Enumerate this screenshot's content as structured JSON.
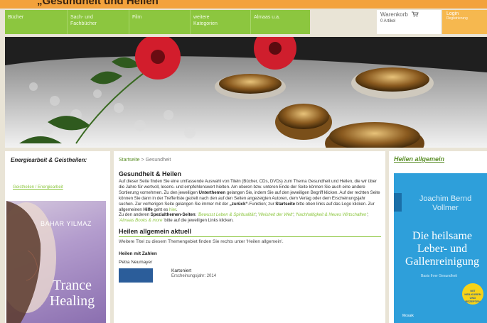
{
  "caption": "„Gesundheit und Heilen",
  "nav": {
    "items": [
      "Bücher",
      "Sach- und Fachbücher",
      "Film",
      "weitere Kategorien",
      "Almaas u.a."
    ],
    "cart_label": "Warenkorb",
    "cart_count": "0 Artikel",
    "login_label": "Login",
    "login_sub": "Registrierung"
  },
  "left": {
    "heading": "Energiearbeit & Geistheilen:",
    "link": "Geistheilen / Energiearbeit",
    "book_author": "BAHAR YILMAZ",
    "book_title": "Trance Healing"
  },
  "main": {
    "breadcrumb_home": "Startseite",
    "breadcrumb_sep": " > ",
    "breadcrumb_current": "Gesundheit",
    "title": "Gesundheit & Heilen",
    "p1": "Auf dieser Seite finden Sie eine umfassende Auswahl von Titeln (Bücher, CDs, DVDs) zum Thema Gesundheit und Heilen, die wir über die Jahre für wertvoll, lesens- und empfehlenswert hielten. Am oberen bzw. unteren Ende der Seite können Sie auch eine andere Sortierung vornehmen. Zu den jeweiligen ",
    "p1_bold": "Unterthemen",
    "p1b": " gelangen Sie, indem Sie auf den jeweiligen Begriff klicken. Auf der rechten Seite können Sie dann in der Trefferliste gezielt nach den auf den Seiten angezeigten Autoren, dem Verlag oder dem Erscheinungsjahr suchen. Zur vorherigen Seite gelangen Sie immer mit der ",
    "p1_bold2": "„zurück“",
    "p1c": "-Funktion; zur ",
    "p1_bold3": "Startseite",
    "p1d": " bitte oben links auf das Logo klicken. Zur allgemeinen ",
    "p1_bold4": "Hilfe",
    "p1e": " geht es ",
    "p1_link": "hier",
    "p1f": ".",
    "p2": "Zu den anderen ",
    "p2_bold": "Spezialthemen-Seiten",
    "p2b": ": ",
    "p2_link1": "'Bewusst Leben & Spiritualität'",
    "p2c": "; ",
    "p2_link2": "'Weisheit der Welt'",
    "p2d": "; ",
    "p2_link3": "'Nachhaltigkeit & Neues Wirtschaften'",
    "p2e": "; ",
    "p2_link4": "'Almaas Books & more'",
    "p2f": " bitte auf die jeweiligen Links klicken.",
    "h2": "Heilen allgemein aktuell",
    "sub": "Weitere Titel zu diesem Themengebiet finden Sie rechts unter 'Heilen allgemein'.",
    "item_title": "Heilen mit Zahlen",
    "item_author": "Petra Neumayer",
    "item_format": "Kartoniert",
    "item_format_sub": "Erscheinungsjahr: 2014"
  },
  "right": {
    "heading": "Heilen allgemein",
    "book_author": "Joachim Bernd Vollmer",
    "book_title": "Die heilsame Leber- und Gallenreinigung",
    "book_series": "Basis Ihrer Gesundheit",
    "book_publisher": "Mosaik",
    "book_badge": "MIT HEILKUREN UND REZEPTEN"
  },
  "colors": {
    "nav_green": "#8cc63f",
    "login_orange": "#f6b84f",
    "link_green": "#5c8f2a",
    "cover_blue": "#2e9fda"
  }
}
